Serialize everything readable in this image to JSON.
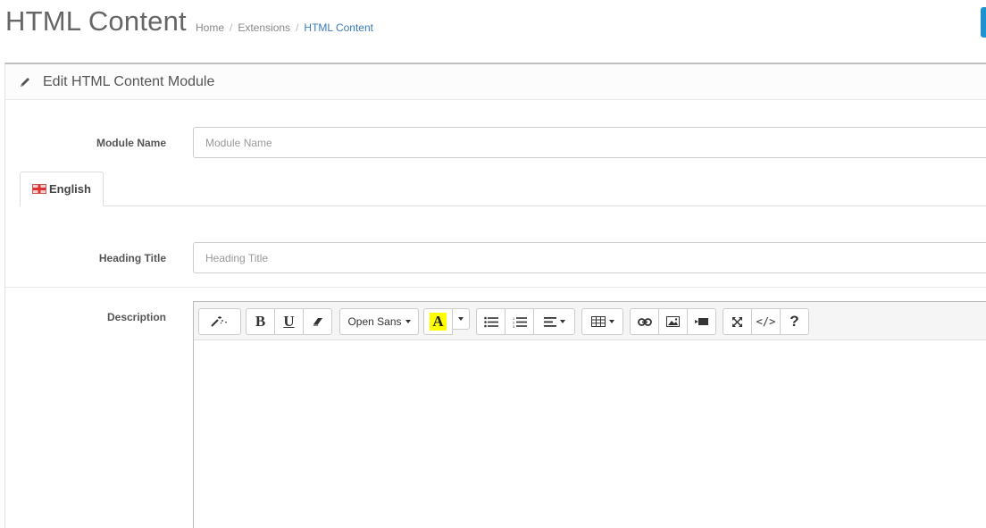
{
  "header": {
    "title": "HTML Content",
    "breadcrumb": [
      {
        "label": "Home",
        "active": false
      },
      {
        "label": "Extensions",
        "active": false
      },
      {
        "label": "HTML Content",
        "active": true
      }
    ],
    "separator": "/"
  },
  "panel": {
    "heading": "Edit HTML Content Module",
    "heading_icon": "pencil-icon"
  },
  "form": {
    "module_name": {
      "label": "Module Name",
      "placeholder": "Module Name",
      "value": ""
    },
    "language_tab": {
      "label": "English",
      "icon": "uk-flag-icon"
    },
    "heading_title": {
      "label": "Heading Title",
      "placeholder": "Heading Title",
      "value": ""
    },
    "description": {
      "label": "Description"
    }
  },
  "editor": {
    "font_name": "Open Sans",
    "toolbar_groups": [
      [
        "magic-wand-icon"
      ],
      [
        "bold-icon",
        "underline-icon",
        "eraser-icon"
      ],
      [
        "font-name-dropdown"
      ],
      [
        "text-color-icon",
        "color-dropdown-icon"
      ],
      [
        "unordered-list-icon",
        "ordered-list-icon",
        "align-icon"
      ],
      [
        "table-icon"
      ],
      [
        "link-icon",
        "picture-icon",
        "video-icon"
      ],
      [
        "fullscreen-icon",
        "code-view-icon",
        "help-icon"
      ]
    ],
    "bold_glyph": "B",
    "underline_glyph": "U",
    "text_color_glyph": "A",
    "code_glyph": "</>",
    "help_glyph": "?",
    "highlight_color": "#ffff00"
  },
  "colors": {
    "accent": "#1e91cf",
    "breadcrumb_active": "#3a7bbf"
  }
}
